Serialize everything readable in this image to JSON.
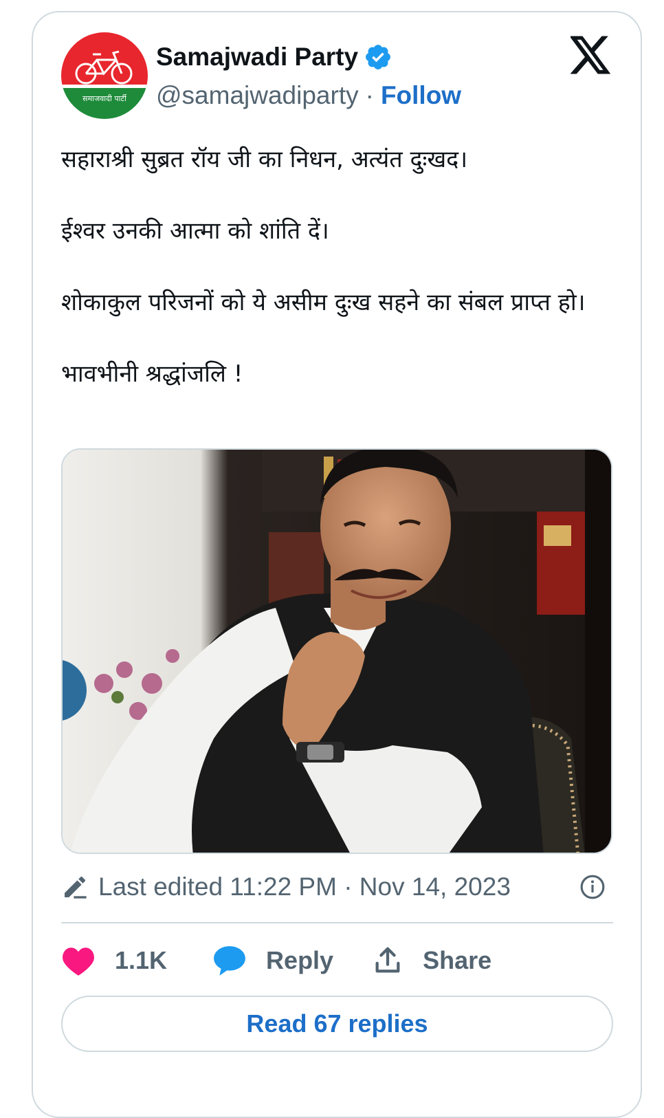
{
  "author": {
    "name": "Samajwadi Party",
    "handle": "@samajwadiparty",
    "separator": "·",
    "follow_label": "Follow",
    "avatar_text": "समाजवादी पार्टी",
    "verified_icon": "verified-badge-icon"
  },
  "platform_icon": "x-logo-icon",
  "tweet": {
    "paragraphs": [
      "सहाराश्री सुब्रत रॉय जी का निधन, अत्यंत दुःखद।",
      "ईश्वर उनकी आत्मा को शांति दें।",
      "शोकाकुल परिजनों को ये असीम दुःख सहने का संबल प्राप्त हो।",
      "भावभीनी श्रद्धांजलि !"
    ]
  },
  "meta": {
    "edited_text": "Last edited 11:22 PM · Nov 14, 2023",
    "edit_icon": "pencil-icon",
    "info_icon": "info-icon"
  },
  "actions": {
    "like_count": "1.1K",
    "reply_label": "Reply",
    "share_label": "Share"
  },
  "read_replies_label": "Read 67 replies",
  "colors": {
    "link": "#1d6fc8",
    "like": "#f91880",
    "reply_icon": "#1d9bf0",
    "muted": "#536471",
    "border": "#cfd9de",
    "avatar_red": "#e8262d",
    "avatar_green": "#1e8b3a"
  }
}
